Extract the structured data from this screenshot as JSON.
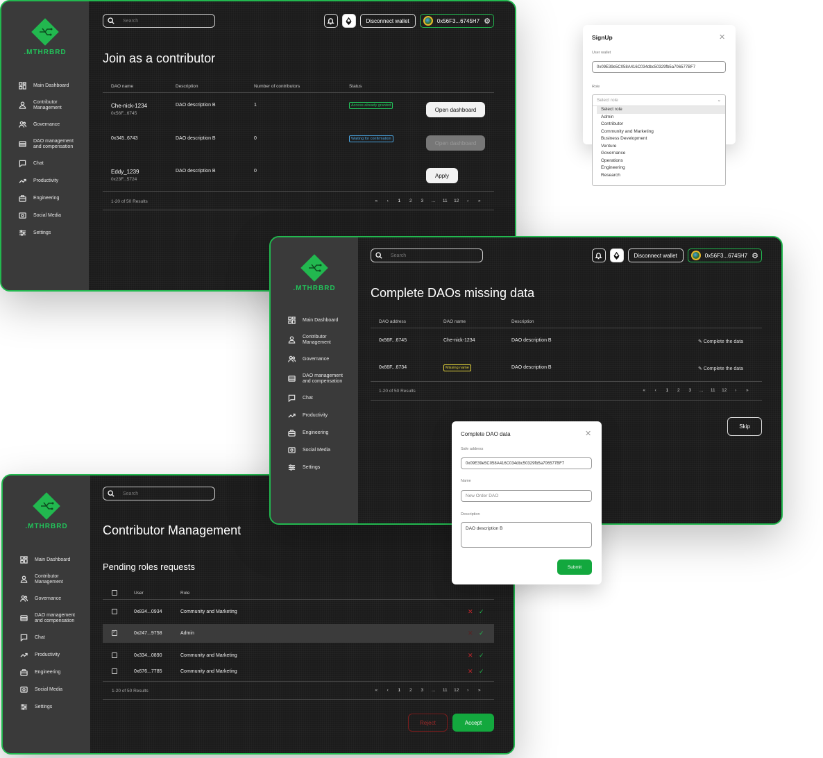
{
  "brand": "MTHRBRD",
  "nav": [
    {
      "label": "Main Dashboard",
      "icon": "dashboard-icon"
    },
    {
      "label": "Contributor Management",
      "icon": "user-icon"
    },
    {
      "label": "Governance",
      "icon": "users-icon"
    },
    {
      "label": "DAO management and compensation",
      "icon": "wallet-icon"
    },
    {
      "label": "Chat",
      "icon": "chat-icon"
    },
    {
      "label": "Productivity",
      "icon": "trend-icon"
    },
    {
      "label": "Engineering",
      "icon": "toolbox-icon"
    },
    {
      "label": "Social Media",
      "icon": "media-icon"
    },
    {
      "label": "Settings",
      "icon": "settings-icon"
    }
  ],
  "search_placeholder": "Search",
  "topbar": {
    "disconnect": "Disconnect wallet",
    "wallet": "0x56F3...6745H7"
  },
  "w1": {
    "title": "Join as a contributor",
    "headers": [
      "DAO name",
      "Description",
      "Number of contributors",
      "Status"
    ],
    "rows": [
      {
        "name": "Che-nick-1234",
        "addr": "0x56F...6745",
        "desc": "DAO description B",
        "count": "1",
        "status": "Access already granted",
        "action": "Open dashboard"
      },
      {
        "name": "",
        "addr": "0x345..6743",
        "desc": "DAO description B",
        "count": "0",
        "status": "Waiting for confirmation",
        "action": "Open dashboard"
      },
      {
        "name": "Eddy_1239",
        "addr": "0x23F...5724",
        "desc": "DAO description B",
        "count": "0",
        "status": "",
        "action": "Apply"
      }
    ],
    "results": "1-20 of 50 Results"
  },
  "pager": [
    "«",
    "‹",
    "1",
    "2",
    "3",
    "...",
    "11",
    "12",
    "›",
    "»"
  ],
  "signup": {
    "title": "SignUp",
    "wallet_label": "User wallet",
    "wallet": "0x09E39e5C058A416C034dbc50329fb5a706577BF7",
    "role_label": "Role",
    "role_placeholder": "Select role",
    "options": [
      "Select role",
      "Admin",
      "Contributor",
      "Community and Marketing",
      "Business Development",
      "Venture",
      "Governance",
      "Operations",
      "Engineering",
      "Research"
    ]
  },
  "w2": {
    "title": "Complete DAOs missing data",
    "headers": [
      "DAO address",
      "DAO name",
      "Description"
    ],
    "rows": [
      {
        "addr": "0x56F...6745",
        "name": "Che-nick-1234",
        "desc": "DAO description B",
        "action": "Complete the data"
      },
      {
        "addr": "0x66F...6734",
        "name": "Missing name",
        "desc": "DAO description B",
        "action": "Complete the data"
      }
    ],
    "results": "1-20 of 50 Results",
    "skip": "Skip"
  },
  "modal": {
    "title": "Complete DAO data",
    "safe_label": "Safe address",
    "safe": "0x09E39e5C058A416C034dbc50329fb5a706577BF7",
    "name_label": "Name",
    "name_placeholder": "New Order DAO",
    "desc_label": "Description",
    "desc": "DAO description B",
    "submit": "Submit"
  },
  "w3": {
    "title": "Contributor Management",
    "subtitle": "Pending roles requests",
    "headers": [
      "User",
      "Role"
    ],
    "rows": [
      {
        "user": "0x834...0934",
        "role": "Community and Marketing",
        "checked": false
      },
      {
        "user": "0x247...9758",
        "role": "Admin",
        "checked": true
      },
      {
        "user": "0x334...0890",
        "role": "Community and Marketing",
        "checked": false
      },
      {
        "user": "0x676...7785",
        "role": "Community and Marketing",
        "checked": false
      }
    ],
    "results": "1-20 of 50 Results",
    "reject": "Reject",
    "accept": "Accept"
  },
  "colors": {
    "accent": "#22b84f",
    "panel": "#1b1b1b",
    "sidebar": "#3a3a3a"
  }
}
